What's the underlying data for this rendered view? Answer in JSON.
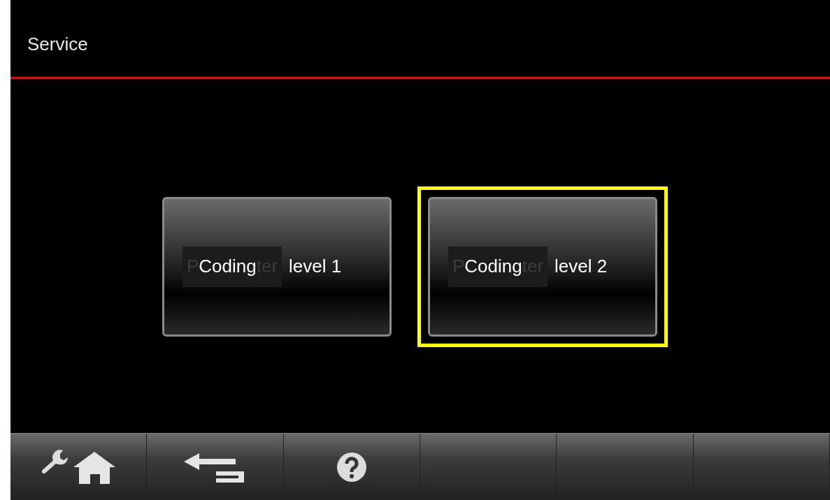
{
  "header": {
    "title": "Service"
  },
  "buttons": [
    {
      "ghost_prefix": "P",
      "overlay": "Coding",
      "ghost_suffix": "ter",
      "label": "level 1",
      "selected": false
    },
    {
      "ghost_prefix": "P",
      "overlay": "Coding",
      "ghost_suffix": "ter",
      "label": "level 2",
      "selected": true
    }
  ],
  "toolbar": [
    {
      "kind": "service-home"
    },
    {
      "kind": "back"
    },
    {
      "kind": "help"
    },
    {
      "kind": "empty"
    },
    {
      "kind": "empty"
    },
    {
      "kind": "empty"
    }
  ]
}
